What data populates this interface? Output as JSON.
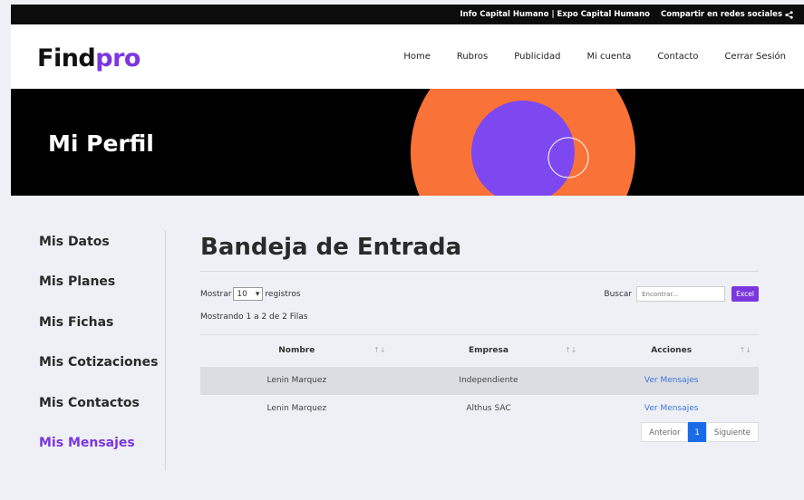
{
  "topbar": {
    "links": "Info Capital Humano | Expo Capital Humano",
    "share": "Compartir en redes sociales"
  },
  "logo": {
    "part1": "Find",
    "part2": "pro"
  },
  "nav": [
    "Home",
    "Rubros",
    "Publicidad",
    "Mi cuenta",
    "Contacto",
    "Cerrar Sesión"
  ],
  "hero": {
    "title": "Mi Perfil"
  },
  "sidebar": {
    "items": [
      "Mis Datos",
      "Mis Planes",
      "Mis Fichas",
      "Mis Cotizaciones",
      "Mis Contactos",
      "Mis Mensajes"
    ],
    "active": "Mis Mensajes"
  },
  "main": {
    "title": "Bandeja de Entrada",
    "show_prefix": "Mostrar",
    "show_value": "10",
    "show_suffix": "registros",
    "info": "Mostrando 1 a 2 de 2 Filas",
    "search_label": "Buscar",
    "search_placeholder": "Encontrar...",
    "excel_label": "Excel"
  },
  "table": {
    "headers": [
      "Nombre",
      "Empresa",
      "Acciones"
    ],
    "rows": [
      {
        "nombre": "Lenin Marquez",
        "empresa": "Independiente",
        "accion": "Ver Mensajes"
      },
      {
        "nombre": "Lenin Marquez",
        "empresa": "Althus SAC",
        "accion": "Ver Mensajes"
      }
    ]
  },
  "pager": {
    "prev": "Anterior",
    "current": "1",
    "next": "Siguiente"
  },
  "colors": {
    "accent": "#7b36e0",
    "orange": "#f97237",
    "link": "#3f74d6",
    "page_blue": "#1a6be8"
  }
}
